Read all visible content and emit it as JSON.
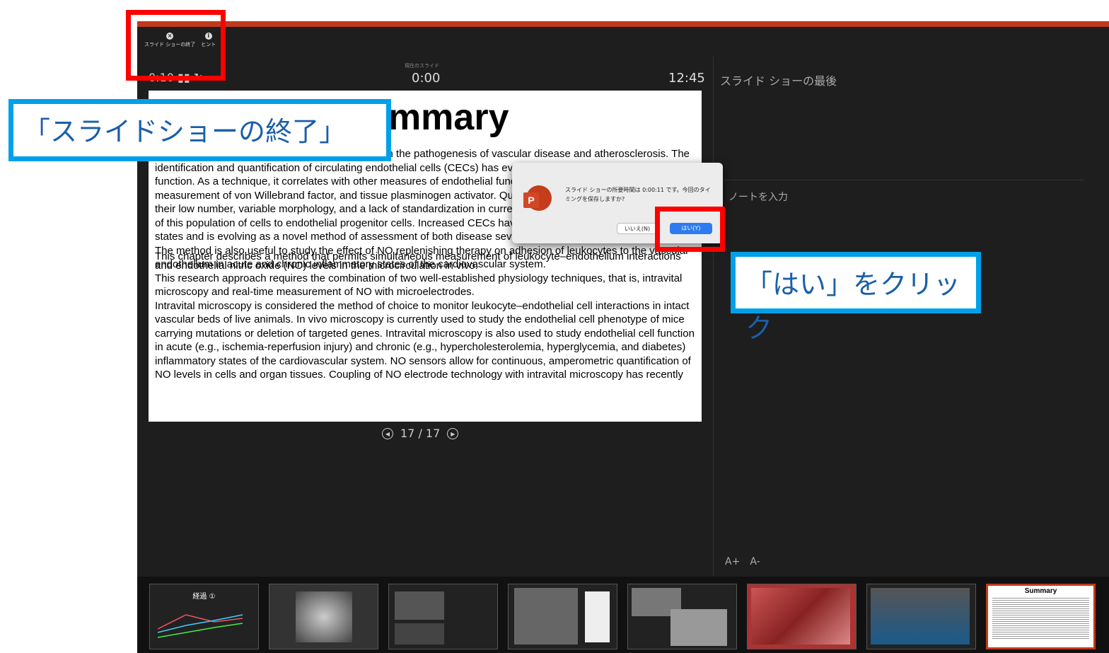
{
  "topbar": {
    "end_show": "スライド ショーの終了",
    "end_icon": "×",
    "hint": "ヒント",
    "hint_icon": "i"
  },
  "timer": {
    "elapsed": "0:10 ▮▮ ↻",
    "current_slide_label": "現在のスライド",
    "current_time": "0:00",
    "clock": "12:45"
  },
  "slide": {
    "title": "Summary",
    "paragraphs": [
      "Endothelial injury represents a key initiating step in the pathogenesis of vascular disease and atherosclerosis. The identification and quantification of circulating endothelial cells (CECs) has evolved as a novel marker of endothelial function. As a technique, it correlates with other measures of endothelial function such as flow-mediated dilation, the measurement of von Willebrand factor, and tissue plasminogen activator. Quantification of CECs is difficult due to their low number, variable morphology, and a lack of standardization in current techniques used, as well as similarity of this population of cells to endothelial progenitor cells. Increased CECs have been reported in many disease states and is evolving as a novel method of assessment of both disease severity and response to treatment."
    ],
    "overlap_text": "This chapter describes a method that permits simultaneous measurement of leukocyte–endothelium interactions and endothelial nitric oxide (NO) levels in the microcirculation in vivo.",
    "paragraphs2": [
      "The method is also useful to study the effect of NO replenishing therapy on adhesion of leukocytes to the vascular endothelium in acute and chronic inflammatory states of the cardiovascular system.",
      "This research approach requires the combination of two well-established physiology techniques, that is, intravital microscopy and real-time measurement of NO with microelectrodes.",
      "Intravital microscopy is considered the method of choice to monitor leukocyte–endothelial cell interactions in intact vascular beds of live animals. In vivo microscopy is currently used to study the endothelial cell phenotype of mice carrying mutations or deletion of targeted genes. Intravital microscopy is also used to study endothelial cell function in acute (e.g., ischemia-reperfusion injury) and chronic (e.g., hypercholesterolemia, hyperglycemia, and diabetes) inflammatory states of the cardiovascular system. NO sensors allow for continuous, amperometric quantification of NO levels in cells and organ tissues. Coupling of NO electrode technology with intravital microscopy has recently"
    ]
  },
  "nav": {
    "prev": "◀",
    "counter": "17 / 17",
    "next": "▶"
  },
  "next_panel": {
    "label": "スライド ショーの最後"
  },
  "notes": {
    "placeholder": "ノートを入力"
  },
  "font_controls": {
    "increase": "A+",
    "decrease": "A-"
  },
  "thumbnails": [
    {
      "label": "経過 ①"
    },
    {
      "label": ""
    },
    {
      "label": ""
    },
    {
      "label": ""
    },
    {
      "label": ""
    },
    {
      "label": ""
    },
    {
      "label": ""
    },
    {
      "label": "Summary"
    }
  ],
  "dialog": {
    "message": "スライド ショーの所要時間は 0:00:11 です。今回のタイミングを保存しますか?",
    "no_label": "いいえ(N)",
    "yes_label": "はい(Y)",
    "app_icon_letter": "P"
  },
  "callouts": {
    "end_show": "「スライドショーの終了」",
    "click_yes": "「はい」をクリック"
  },
  "colors": {
    "accent": "#c0391b",
    "highlight_red": "#ff0000",
    "callout_blue": "#00a0e9",
    "button_blue": "#2d7bf0"
  }
}
